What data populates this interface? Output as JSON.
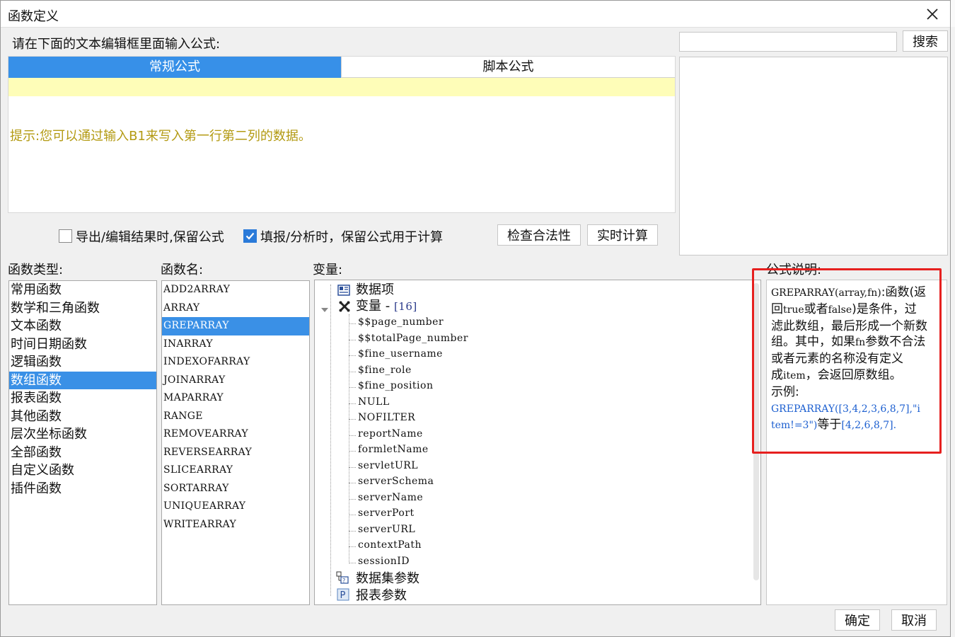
{
  "dialog": {
    "title": "函数定义",
    "editor_prompt": "请在下面的文本编辑框里面输入公式:",
    "tabs": [
      {
        "label": "常规公式",
        "active": true
      },
      {
        "label": "脚本公式",
        "active": false
      }
    ],
    "formula_value": "",
    "hint": "提示:您可以通过输入B1来写入第一行第二列的数据。",
    "search": {
      "value": "",
      "button": "搜索"
    },
    "options": {
      "keep_formula_export": {
        "label": "导出/编辑结果时,保留公式",
        "checked": false
      },
      "keep_formula_fill": {
        "label": "填报/分析时，保留公式用于计算",
        "checked": true
      }
    },
    "buttons": {
      "check": "检查合法性",
      "realtime": "实时计算",
      "ok": "确定",
      "cancel": "取消"
    }
  },
  "sections": {
    "func_type": "函数类型:",
    "func_name": "函数名:",
    "variables": "变量:",
    "description": "公式说明:"
  },
  "func_types": [
    "常用函数",
    "数学和三角函数",
    "文本函数",
    "时间日期函数",
    "逻辑函数",
    "数组函数",
    "报表函数",
    "其他函数",
    "层次坐标函数",
    "全部函数",
    "自定义函数",
    "插件函数"
  ],
  "func_type_selected": "数组函数",
  "func_names": [
    "ADD2ARRAY",
    "ARRAY",
    "GREPARRAY",
    "INARRAY",
    "INDEXOFARRAY",
    "JOINARRAY",
    "MAPARRAY",
    "RANGE",
    "REMOVEARRAY",
    "REVERSEARRAY",
    "SLICEARRAY",
    "SORTARRAY",
    "UNIQUEARRAY",
    "WRITEARRAY"
  ],
  "func_name_selected": "GREPARRAY",
  "variables": {
    "data_items": "数据项",
    "var_group": "变量",
    "var_sep": " - ",
    "var_count": "[16]",
    "var_list": [
      "$$page_number",
      "$$totalPage_number",
      "$fine_username",
      "$fine_role",
      "$fine_position",
      "NULL",
      "NOFILTER",
      "reportName",
      "formletName",
      "servletURL",
      "serverSchema",
      "serverName",
      "serverPort",
      "serverURL",
      "contextPath",
      "sessionID"
    ],
    "dataset_params": "数据集参数",
    "report_params": "报表参数"
  },
  "description": {
    "l1a": "GREPARRAY(array,fn)",
    "l1b": ":函数(返",
    "l2a": "回",
    "l2b": "true",
    "l2c": "或者",
    "l2d": "false",
    "l2e": ")是条件，过",
    "l3": "滤此数组，最后形成一个新数",
    "l4a": "组。其中，如果",
    "l4b": "fn",
    "l4c": "参数不合法",
    "l5": "或者元素的名称没有定义",
    "l6a": "成",
    "l6b": "item",
    "l6c": "，会返回原数组。",
    "l7": "示例:",
    "l8a": "GREPARRAY(",
    "l8b": "[3,4,2,3,6,8,7]",
    "l8c": ",\"i",
    "l9a": "tem!=3\")",
    "l9b": "等于",
    "l9c": "[4,2,6,8,7]",
    "l9d": "."
  },
  "colors": {
    "accent": "#3a90e6",
    "hint": "#b39a12",
    "formula_bg": "#fefdb8",
    "highlight_box": "#e6201f",
    "example_blue": "#1c5fd0"
  }
}
